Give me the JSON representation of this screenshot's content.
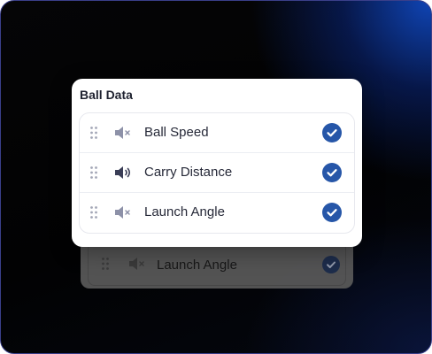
{
  "panel": {
    "title": "Ball Data",
    "items": [
      {
        "label": "Ball Speed",
        "sound": "muted",
        "checked": true
      },
      {
        "label": "Carry Distance",
        "sound": "on",
        "checked": true
      },
      {
        "label": "Launch Angle",
        "sound": "muted",
        "checked": true
      }
    ]
  },
  "drag_preview": {
    "label": "Launch Angle",
    "sound": "muted",
    "checked": true
  },
  "icons": {
    "drag_handle": "drag-handle-icon",
    "muted": "speaker-muted-icon",
    "sound_on": "speaker-on-icon",
    "check": "check-circle-icon"
  },
  "colors": {
    "accent": "#2656a8",
    "icon_muted": "#8d91a8",
    "icon_active": "#3a3d56",
    "text": "#262938"
  }
}
